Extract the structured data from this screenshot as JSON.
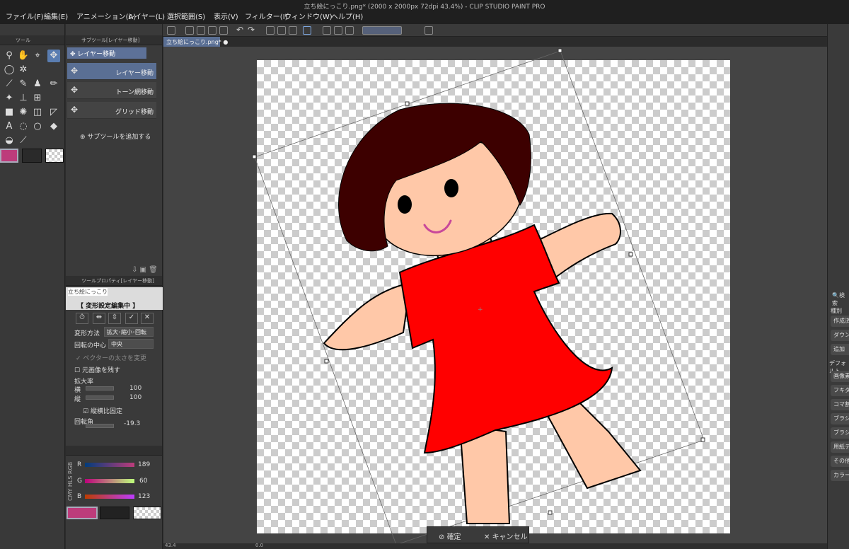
{
  "window": {
    "title": "立ち絵にっこり.png* (2000 x 2000px 72dpi 43.4%)  - CLIP STUDIO PAINT PRO"
  },
  "menu": [
    "ファイル(F)",
    "編集(E)",
    "アニメーション(A)",
    "レイヤー(L)",
    "選択範囲(S)",
    "表示(V)",
    "フィルター(I)",
    "ウィンドウ(W)",
    "ヘルプ(H)"
  ],
  "tool_panel": {
    "header": "ツール"
  },
  "subtool_panel": {
    "header": "サブツール[レイヤー移動]",
    "group_tab": "レイヤー移動",
    "items": [
      "レイヤー移動",
      "トーン網移動",
      "グリッド移動"
    ],
    "add_label": "サブツールを追加する"
  },
  "tool_property": {
    "header": "ツールプロパティ[レイヤー移動]",
    "layer_name": "立ち絵にっこり",
    "editing_banner": "【 変形設定編集中 】",
    "transform_method_label": "変形方法",
    "transform_method_value": "拡大･縮小･回転",
    "rotation_center_label": "回転の中心",
    "rotation_center_value": "中央",
    "vector_width_label": "ベクターの太さを変更",
    "keep_original_label": "元画像を残す",
    "scale_label": "拡大率",
    "width_label": "横",
    "width_value": "100",
    "height_label": "縦",
    "height_value": "100",
    "keep_ratio_label": "縦横比固定",
    "rotation_label": "回転角",
    "rotation_value": "-19.3"
  },
  "color": {
    "modes": "CMY HLS RGB",
    "r_label": "R",
    "r_value": "189",
    "g_label": "G",
    "g_value": "60",
    "b_label": "B",
    "b_value": "123",
    "main_hex": "#bd3c7b"
  },
  "document": {
    "tab_label": "立ち絵にっこり.png*"
  },
  "transform_bar": {
    "ok_label": "確定",
    "cancel_label": "キャンセル"
  },
  "status": {
    "zoom": "43.4",
    "zoom2": "0.0"
  },
  "right_panel": {
    "search": "検索",
    "kind": "種別",
    "buttons": [
      "作成済",
      "ダウンロード",
      "追加",
      "デフォルト",
      "画像素材",
      "フキダシ",
      "コマ割",
      "ブラシ",
      "ブラシ",
      "用紙テ",
      "その他",
      "カラー"
    ]
  }
}
